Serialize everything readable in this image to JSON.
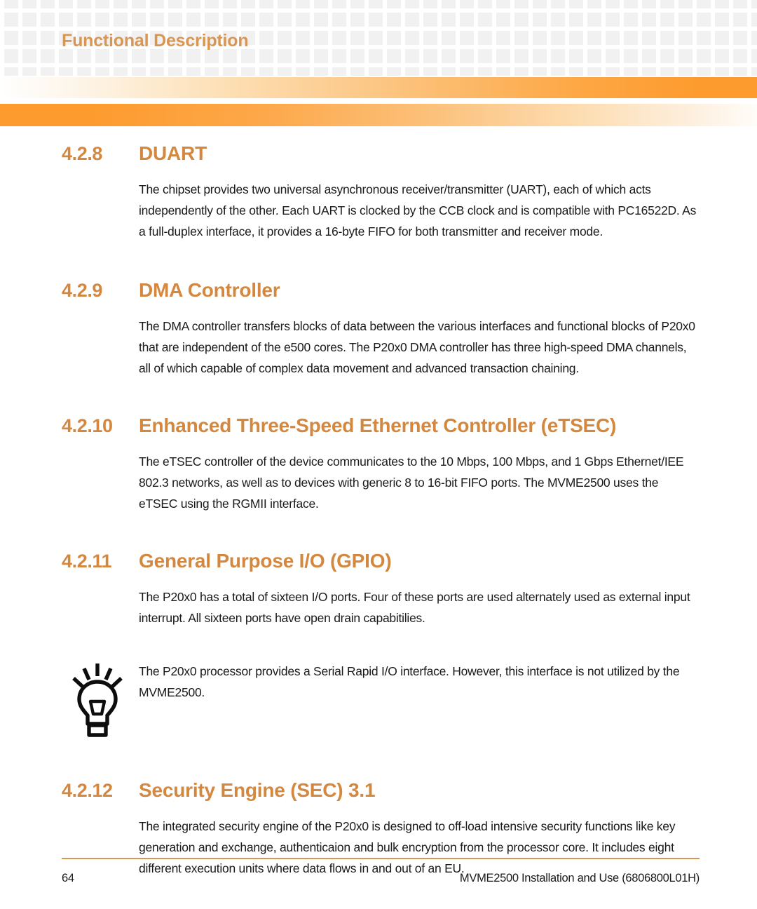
{
  "header": {
    "title": "Functional Description",
    "title_color": "#d99552",
    "pattern_color": "#f1f1f1",
    "bar_accent_color": "#fd9b2e"
  },
  "sections": [
    {
      "number": "4.2.8",
      "title": "DUART",
      "body": "The chipset provides two universal asynchronous receiver/transmitter (UART), each of which acts independently of the other. Each UART is clocked by the CCB clock and is compatible with PC16522D. As a full-duplex interface, it provides a 16-byte FIFO for both transmitter and receiver mode."
    },
    {
      "number": "4.2.9",
      "title": "DMA Controller",
      "body": "The DMA controller transfers blocks of data between the various interfaces and functional blocks of P20x0 that are independent of the e500 cores. The P20x0 DMA controller has three high-speed DMA  channels, all of which capable of complex data movement and advanced transaction chaining."
    },
    {
      "number": "4.2.10",
      "title": "Enhanced Three-Speed Ethernet Controller (eTSEC)",
      "body": "The eTSEC controller of the device communicates to the 10 Mbps, 100 Mbps, and 1 Gbps Ethernet/IEE 802.3 networks, as well as to devices with generic 8 to 16-bit FIFO ports. The MVME2500 uses the eTSEC using the RGMII interface."
    },
    {
      "number": "4.2.11",
      "title": "General Purpose I/O (GPIO)",
      "body": "The P20x0 has a total of sixteen I/O ports. Four of these ports are used alternately used as external input interrupt. All sixteen ports have open drain capabitilies."
    },
    {
      "number": "4.2.12",
      "title": "Security Engine (SEC) 3.1",
      "body": "The integrated security engine of the P20x0 is designed to off-load intensive security functions like key generation and exchange, authenticaion and bulk encryption from the processor core. It includes eight different execution units where data flows in and out of an EU."
    }
  ],
  "note": {
    "icon": "lightbulb-tip-icon",
    "text": "The P20x0 processor provides a Serial Rapid I/O interface. However, this interface is not utilized by the MVME2500."
  },
  "footer": {
    "page_number": "64",
    "document_title": "MVME2500 Installation and Use (6806800L01H)",
    "rule_color": "#d99552"
  }
}
